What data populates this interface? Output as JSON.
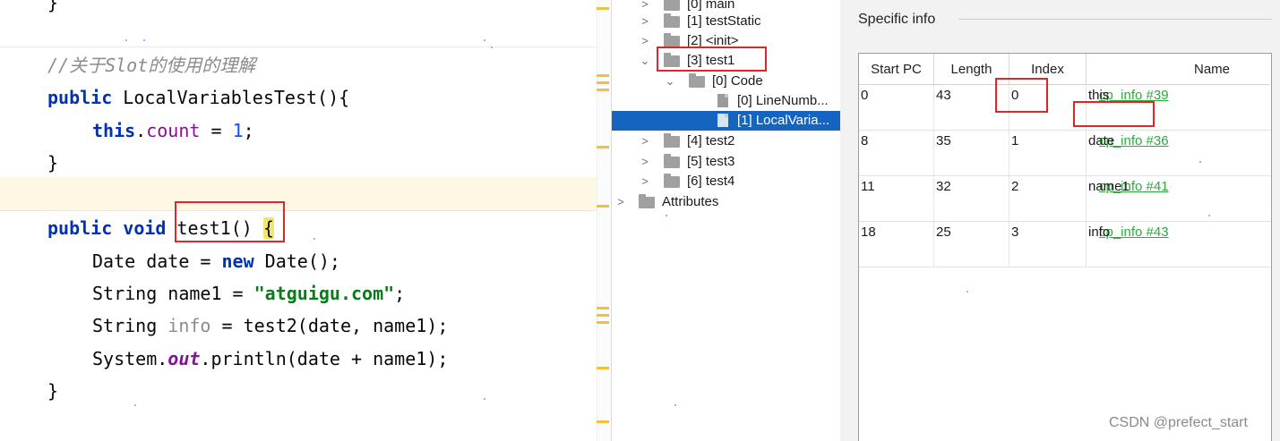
{
  "editor": {
    "lines": {
      "prev_brace": "}",
      "comment": "//关于Slot的使用的理解",
      "ctor_kw": "public",
      "ctor_name": " LocalVariablesTest(){",
      "this_kw": "this",
      "dot": ".",
      "count_field": "count",
      "assign": " = ",
      "one": "1",
      "semi": ";",
      "ctor_close": "}",
      "m_public": "public",
      "m_void": "void",
      "m_name": " test1() ",
      "m_brace": "{",
      "l1_a": "Date date = ",
      "l1_new": "new",
      "l1_b": " Date();",
      "l2_a": "String name1 = ",
      "l2_str": "\"atguigu.com\"",
      "l2_b": ";",
      "l3_a": "String ",
      "l3_info": "info",
      "l3_b": " = test2(date, name1);",
      "l4_a": "System.",
      "l4_out": "out",
      "l4_b": ".println(date + name1);",
      "m_close": "}"
    }
  },
  "tree": {
    "nodes": [
      {
        "label": "[0] main"
      },
      {
        "label": "[1] testStatic"
      },
      {
        "label": "[2] <init>"
      },
      {
        "label": "[3] test1"
      },
      {
        "label": "[0] Code"
      },
      {
        "label": "[0] LineNumb..."
      },
      {
        "label": "[1] LocalVaria..."
      },
      {
        "label": "[4] test2"
      },
      {
        "label": "[5] test3"
      },
      {
        "label": "[6] test4"
      },
      {
        "label": "Attributes"
      }
    ]
  },
  "info": {
    "title": "Specific info",
    "columns": [
      "Start PC",
      "Length",
      "Index",
      "Name"
    ],
    "rows": [
      {
        "start_pc": "0",
        "length": "43",
        "index": "0",
        "link": "cp_info #39",
        "name": "this"
      },
      {
        "start_pc": "8",
        "length": "35",
        "index": "1",
        "link": "cp_info #36",
        "name": "date"
      },
      {
        "start_pc": "11",
        "length": "32",
        "index": "2",
        "link": "cp_info #41",
        "name": "name1"
      },
      {
        "start_pc": "18",
        "length": "25",
        "index": "3",
        "link": "cp_info #43",
        "name": "info"
      }
    ]
  },
  "colors": {
    "annotation_red": "#e0262b",
    "selection_blue": "#1565c0",
    "link_green": "#2bab3a"
  },
  "watermark": "CSDN @prefect_start"
}
